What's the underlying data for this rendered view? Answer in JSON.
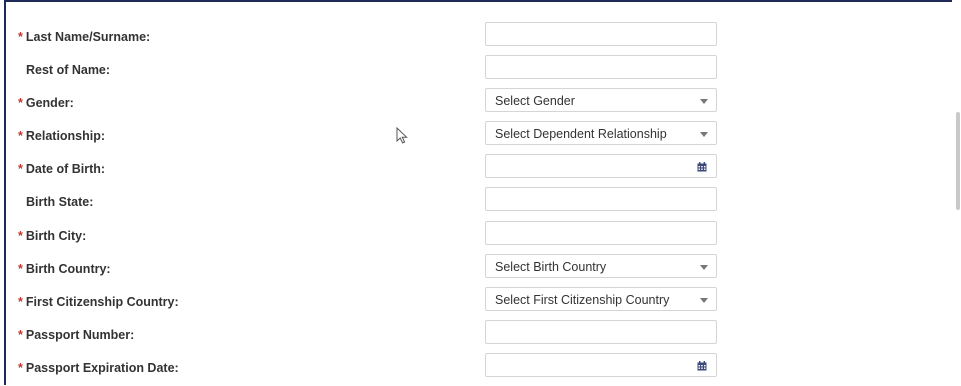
{
  "form": {
    "fields": [
      {
        "label": "Last Name/Surname:",
        "required": true,
        "type": "text",
        "value": ""
      },
      {
        "label": "Rest of Name:",
        "required": false,
        "type": "text",
        "value": ""
      },
      {
        "label": "Gender:",
        "required": true,
        "type": "select",
        "value": "Select Gender"
      },
      {
        "label": "Relationship:",
        "required": true,
        "type": "select",
        "value": "Select Dependent Relationship"
      },
      {
        "label": "Date of Birth:",
        "required": true,
        "type": "date",
        "value": ""
      },
      {
        "label": "Birth State:",
        "required": false,
        "type": "text",
        "value": ""
      },
      {
        "label": "Birth City:",
        "required": true,
        "type": "text",
        "value": ""
      },
      {
        "label": "Birth Country:",
        "required": true,
        "type": "select",
        "value": "Select Birth Country"
      },
      {
        "label": "First Citizenship Country:",
        "required": true,
        "type": "select",
        "value": "Select First Citizenship Country"
      },
      {
        "label": "Passport Number:",
        "required": true,
        "type": "text",
        "value": ""
      },
      {
        "label": "Passport Expiration Date:",
        "required": true,
        "type": "date",
        "value": ""
      }
    ]
  },
  "required_marker": "*",
  "colors": {
    "required": "#c0392b",
    "frame": "#1f2a5a",
    "field_border": "#d5d5d5",
    "accent_icon": "#3b4a7a"
  }
}
